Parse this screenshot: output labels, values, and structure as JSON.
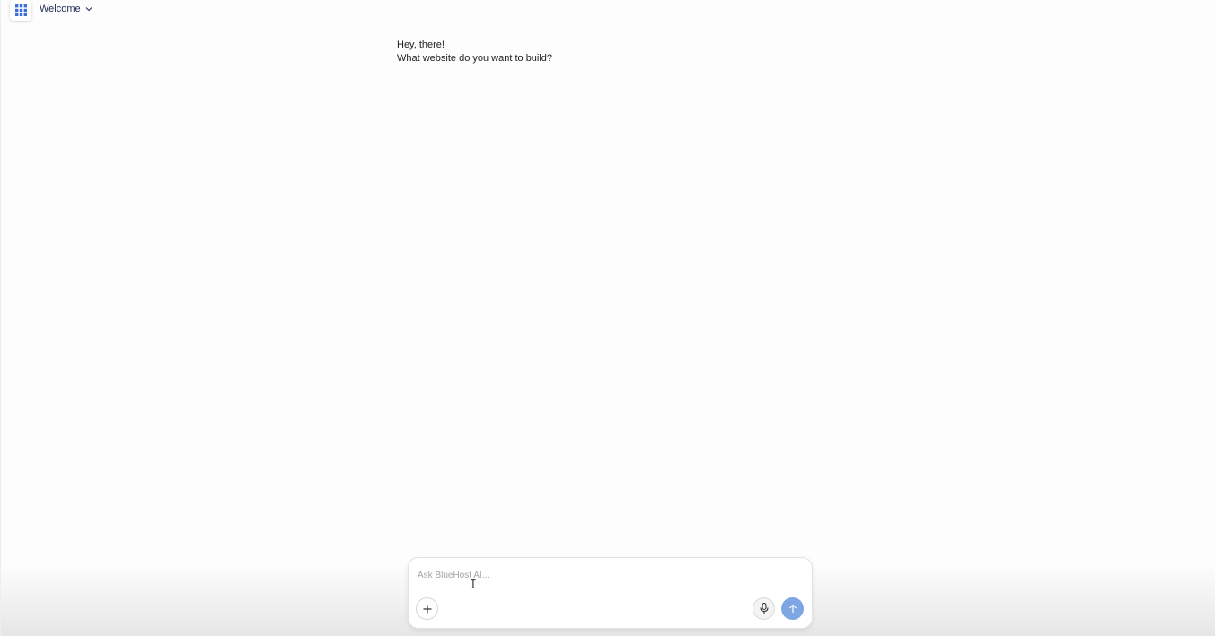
{
  "topbar": {
    "apps_icon": "grid-icon",
    "page_selector_label": "Welcome",
    "page_selector_icon": "chevron-down-icon"
  },
  "chat": {
    "greeting_line1": "Hey, there!",
    "greeting_line2": "What website do you want to build?"
  },
  "composer": {
    "input_value": "",
    "placeholder": "Ask BlueHost AI...",
    "add_icon": "plus-icon",
    "mic_icon": "microphone-icon",
    "send_icon": "arrow-up-icon"
  },
  "colors": {
    "accent": "#3a6fd8",
    "send_button": "#7ea6e3",
    "background": "#fdfdfd"
  }
}
